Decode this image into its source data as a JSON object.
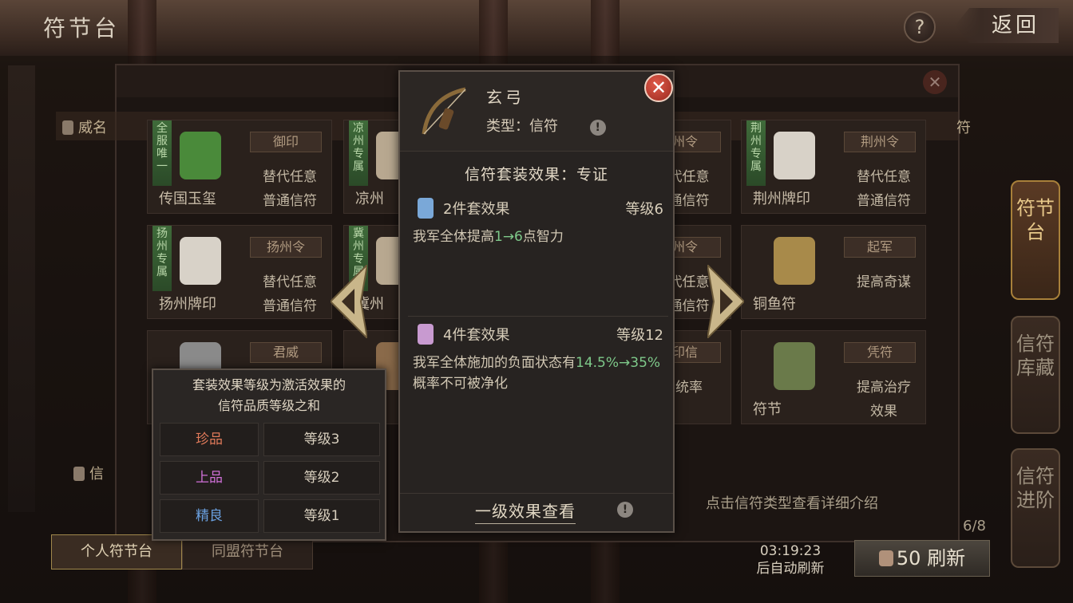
{
  "header": {
    "title": "符节台",
    "help_label": "?",
    "back_label": "返回"
  },
  "side_tabs": [
    {
      "label": "符节台",
      "active": true
    },
    {
      "label": "信符库藏",
      "active": false
    },
    {
      "label": "信符进阶",
      "active": false
    }
  ],
  "main": {
    "bar_left_label": "威名",
    "bar_right_label": "符",
    "bottom_left_label": "信",
    "hint": "点击信符类型查看详细介绍",
    "page_counter": "6/8",
    "tabs": [
      {
        "label": "个人符节台",
        "active": true
      },
      {
        "label": "同盟符节台",
        "active": false
      }
    ],
    "timer": {
      "time": "03:19:23",
      "label": "后自动刷新"
    },
    "refresh": {
      "cost": "50",
      "label": "刷新"
    },
    "cards": [
      {
        "tag": "全服唯一",
        "name": "传国玉玺",
        "badge": "御印",
        "desc": [
          "替代任意",
          "普通信符"
        ],
        "icon_color": "#4a8a3a"
      },
      {
        "tag": "凉州专属",
        "name": "凉州",
        "badge": "",
        "desc": [],
        "icon_color": "#b8a890"
      },
      {
        "tag": "",
        "name": "",
        "badge": "州令",
        "desc": [
          "代任意",
          "通信符"
        ],
        "icon_color": ""
      },
      {
        "tag": "荆州专属",
        "name": "荆州牌印",
        "badge": "荆州令",
        "desc": [
          "替代任意",
          "普通信符"
        ],
        "icon_color": "#d8d2c8"
      },
      {
        "tag": "扬州专属",
        "name": "扬州牌印",
        "badge": "扬州令",
        "desc": [
          "替代任意",
          "普通信符"
        ],
        "icon_color": "#d8d2c8"
      },
      {
        "tag": "冀州专属",
        "name": "冀州",
        "badge": "",
        "desc": [],
        "icon_color": "#b8a890"
      },
      {
        "tag": "",
        "name": "",
        "badge": "州令",
        "desc": [
          "代任意",
          "通信符"
        ],
        "icon_color": ""
      },
      {
        "tag": "",
        "name": "铜鱼符",
        "badge": "起军",
        "desc": [
          "提高奇谋"
        ],
        "icon_color": "#a88a4a"
      },
      {
        "tag": "",
        "name": "",
        "badge": "君威",
        "desc": [],
        "icon_color": "#8a8a8a"
      },
      {
        "tag": "",
        "name": "",
        "badge": "",
        "desc": [],
        "icon_color": "#8a6a4a"
      },
      {
        "tag": "",
        "name": "",
        "badge": "印信",
        "desc": [
          "统率"
        ],
        "icon_color": ""
      },
      {
        "tag": "",
        "name": "符节",
        "badge": "凭符",
        "desc": [
          "提高治疗",
          "效果"
        ],
        "icon_color": "#6a7a4a"
      }
    ]
  },
  "popup": {
    "item_name": "玄弓",
    "type_label": "类型：",
    "type_value": "信符",
    "set_title": "信符套装效果：专证",
    "effects": [
      {
        "label": "2件套效果",
        "level": "等级6",
        "gem": "#7aa8d8",
        "text_a": "我军全体提高",
        "hl": "1→6",
        "text_b": "点智力"
      },
      {
        "label": "4件套效果",
        "level": "等级12",
        "gem": "#c89ad0",
        "text_a": "我军全体施加的负面状态有",
        "hl": "14.5%→35%",
        "text_b": "概率不可被净化"
      }
    ],
    "footer_link": "一级效果查看",
    "close_label": "✕",
    "info_mark": "!"
  },
  "tooltip": {
    "text_line1": "套装效果等级为激活效果的",
    "text_line2": "信符品质等级之和",
    "rows": [
      {
        "quality": "珍品",
        "level": "等级3",
        "color": "#e07a5a"
      },
      {
        "quality": "上品",
        "level": "等级2",
        "color": "#d070d8"
      },
      {
        "quality": "精良",
        "level": "等级1",
        "color": "#6aa0e0"
      }
    ]
  }
}
